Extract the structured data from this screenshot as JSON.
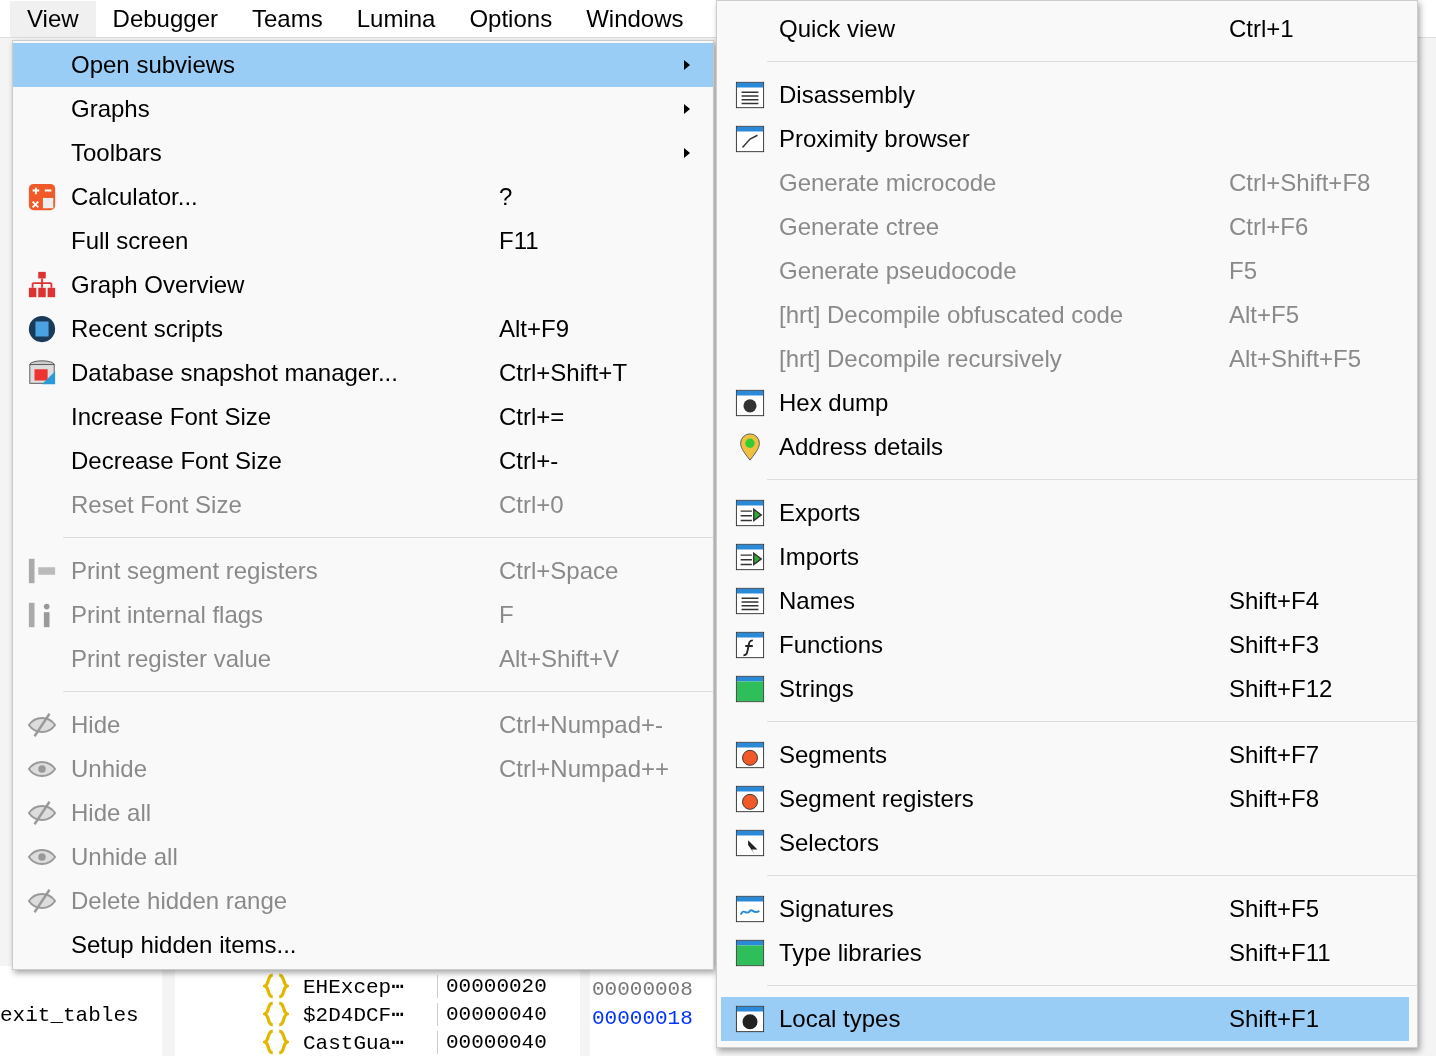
{
  "menubar": [
    {
      "label": "View",
      "selected": true
    },
    {
      "label": "Debugger",
      "selected": false
    },
    {
      "label": "Teams",
      "selected": false
    },
    {
      "label": "Lumina",
      "selected": false
    },
    {
      "label": "Options",
      "selected": false
    },
    {
      "label": "Windows",
      "selected": false
    }
  ],
  "view_menu": [
    {
      "kind": "item",
      "label": "Open subviews",
      "submenu": true,
      "selected": true,
      "disabled": false
    },
    {
      "kind": "item",
      "label": "Graphs",
      "submenu": true,
      "selected": false,
      "disabled": false
    },
    {
      "kind": "item",
      "label": "Toolbars",
      "submenu": true,
      "selected": false,
      "disabled": false
    },
    {
      "kind": "item",
      "label": "Calculator...",
      "shortcut": "?",
      "submenu": false,
      "selected": false,
      "disabled": false
    },
    {
      "kind": "item",
      "label": "Full screen",
      "shortcut": "F11",
      "submenu": false,
      "selected": false,
      "disabled": false
    },
    {
      "kind": "item",
      "label": "Graph Overview",
      "submenu": false,
      "selected": false,
      "disabled": false
    },
    {
      "kind": "item",
      "label": "Recent scripts",
      "shortcut": "Alt+F9",
      "submenu": false,
      "selected": false,
      "disabled": false
    },
    {
      "kind": "item",
      "label": "Database snapshot manager...",
      "shortcut": "Ctrl+Shift+T",
      "submenu": false,
      "selected": false,
      "disabled": false
    },
    {
      "kind": "item",
      "label": "Increase Font Size",
      "shortcut": "Ctrl+=",
      "submenu": false,
      "selected": false,
      "disabled": false
    },
    {
      "kind": "item",
      "label": "Decrease Font Size",
      "shortcut": "Ctrl+-",
      "submenu": false,
      "selected": false,
      "disabled": false
    },
    {
      "kind": "item",
      "label": "Reset Font Size",
      "shortcut": "Ctrl+0",
      "submenu": false,
      "selected": false,
      "disabled": true
    },
    {
      "kind": "separator"
    },
    {
      "kind": "item",
      "label": "Print segment registers",
      "shortcut": "Ctrl+Space",
      "submenu": false,
      "selected": false,
      "disabled": true
    },
    {
      "kind": "item",
      "label": "Print internal flags",
      "shortcut": "F",
      "submenu": false,
      "selected": false,
      "disabled": true
    },
    {
      "kind": "item",
      "label": "Print register value",
      "shortcut": "Alt+Shift+V",
      "submenu": false,
      "selected": false,
      "disabled": true
    },
    {
      "kind": "separator"
    },
    {
      "kind": "item",
      "label": "Hide",
      "shortcut": "Ctrl+Numpad+-",
      "submenu": false,
      "selected": false,
      "disabled": true
    },
    {
      "kind": "item",
      "label": "Unhide",
      "shortcut": "Ctrl+Numpad++",
      "submenu": false,
      "selected": false,
      "disabled": true
    },
    {
      "kind": "item",
      "label": "Hide all",
      "submenu": false,
      "selected": false,
      "disabled": true
    },
    {
      "kind": "item",
      "label": "Unhide all",
      "submenu": false,
      "selected": false,
      "disabled": true
    },
    {
      "kind": "item",
      "label": "Delete hidden range",
      "submenu": false,
      "selected": false,
      "disabled": true
    },
    {
      "kind": "item",
      "label": "Setup hidden items...",
      "submenu": false,
      "selected": false,
      "disabled": false
    }
  ],
  "subviews_menu": [
    {
      "kind": "item",
      "label": "Quick view",
      "shortcut": "Ctrl+1",
      "selected": false,
      "disabled": false
    },
    {
      "kind": "separator"
    },
    {
      "kind": "item",
      "label": "Disassembly",
      "selected": false,
      "disabled": false
    },
    {
      "kind": "item",
      "label": "Proximity browser",
      "selected": false,
      "disabled": false
    },
    {
      "kind": "item",
      "label": "Generate microcode",
      "shortcut": "Ctrl+Shift+F8",
      "selected": false,
      "disabled": true
    },
    {
      "kind": "item",
      "label": "Generate ctree",
      "shortcut": "Ctrl+F6",
      "selected": false,
      "disabled": true
    },
    {
      "kind": "item",
      "label": "Generate pseudocode",
      "shortcut": "F5",
      "selected": false,
      "disabled": true
    },
    {
      "kind": "item",
      "label": "[hrt] Decompile obfuscated code",
      "shortcut": "Alt+F5",
      "selected": false,
      "disabled": true
    },
    {
      "kind": "item",
      "label": "[hrt] Decompile recursively",
      "shortcut": "Alt+Shift+F5",
      "selected": false,
      "disabled": true
    },
    {
      "kind": "item",
      "label": "Hex dump",
      "selected": false,
      "disabled": false
    },
    {
      "kind": "item",
      "label": "Address details",
      "selected": false,
      "disabled": false
    },
    {
      "kind": "separator"
    },
    {
      "kind": "item",
      "label": "Exports",
      "selected": false,
      "disabled": false
    },
    {
      "kind": "item",
      "label": "Imports",
      "selected": false,
      "disabled": false
    },
    {
      "kind": "item",
      "label": "Names",
      "shortcut": "Shift+F4",
      "selected": false,
      "disabled": false
    },
    {
      "kind": "item",
      "label": "Functions",
      "shortcut": "Shift+F3",
      "selected": false,
      "disabled": false
    },
    {
      "kind": "item",
      "label": "Strings",
      "shortcut": "Shift+F12",
      "selected": false,
      "disabled": false
    },
    {
      "kind": "separator"
    },
    {
      "kind": "item",
      "label": "Segments",
      "shortcut": "Shift+F7",
      "selected": false,
      "disabled": false
    },
    {
      "kind": "item",
      "label": "Segment registers",
      "shortcut": "Shift+F8",
      "selected": false,
      "disabled": false
    },
    {
      "kind": "item",
      "label": "Selectors",
      "selected": false,
      "disabled": false
    },
    {
      "kind": "separator"
    },
    {
      "kind": "item",
      "label": "Signatures",
      "shortcut": "Shift+F5",
      "selected": false,
      "disabled": false
    },
    {
      "kind": "item",
      "label": "Type libraries",
      "shortcut": "Shift+F11",
      "selected": false,
      "disabled": false
    },
    {
      "kind": "separator"
    },
    {
      "kind": "item",
      "label": "Local types",
      "shortcut": "Shift+F1",
      "selected": true,
      "disabled": false
    }
  ],
  "background": {
    "names_list": [
      "exit_tables"
    ],
    "types_list": [
      {
        "name": "EHExcep⋯",
        "size": "00000020"
      },
      {
        "name": "$2D4DCF⋯",
        "size": "00000040"
      },
      {
        "name": "CastGua⋯",
        "size": "00000040"
      }
    ],
    "hex_values": [
      {
        "text": "00000008",
        "highlighted": false
      },
      {
        "text": "00000018",
        "highlighted": true
      }
    ]
  }
}
